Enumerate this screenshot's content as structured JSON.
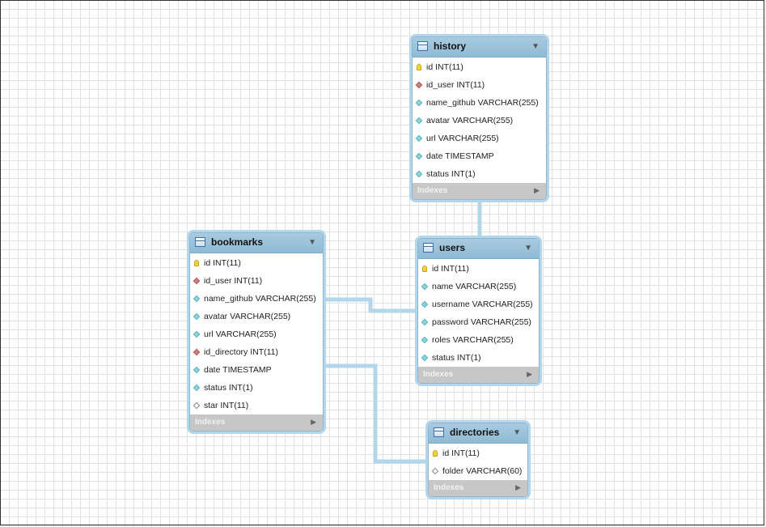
{
  "tables": {
    "history": {
      "title": "history",
      "footer": "Indexes",
      "columns": [
        {
          "text": "id INT(11)",
          "kind": "key"
        },
        {
          "text": "id_user INT(11)",
          "kind": "fk"
        },
        {
          "text": "name_github VARCHAR(255)",
          "kind": "col"
        },
        {
          "text": "avatar VARCHAR(255)",
          "kind": "col"
        },
        {
          "text": "url VARCHAR(255)",
          "kind": "col"
        },
        {
          "text": "date TIMESTAMP",
          "kind": "col"
        },
        {
          "text": "status INT(1)",
          "kind": "col"
        }
      ]
    },
    "bookmarks": {
      "title": "bookmarks",
      "footer": "Indexes",
      "columns": [
        {
          "text": "id INT(11)",
          "kind": "key"
        },
        {
          "text": "id_user INT(11)",
          "kind": "fk"
        },
        {
          "text": "name_github VARCHAR(255)",
          "kind": "col"
        },
        {
          "text": "avatar VARCHAR(255)",
          "kind": "col"
        },
        {
          "text": "url VARCHAR(255)",
          "kind": "col"
        },
        {
          "text": "id_directory INT(11)",
          "kind": "fk"
        },
        {
          "text": "date TIMESTAMP",
          "kind": "col"
        },
        {
          "text": "status INT(1)",
          "kind": "col"
        },
        {
          "text": "star INT(11)",
          "kind": "nul"
        }
      ]
    },
    "users": {
      "title": "users",
      "footer": "Indexes",
      "columns": [
        {
          "text": "id INT(11)",
          "kind": "key"
        },
        {
          "text": "name VARCHAR(255)",
          "kind": "col"
        },
        {
          "text": "username VARCHAR(255)",
          "kind": "col"
        },
        {
          "text": "password VARCHAR(255)",
          "kind": "col"
        },
        {
          "text": "roles VARCHAR(255)",
          "kind": "col"
        },
        {
          "text": "status INT(1)",
          "kind": "col"
        }
      ]
    },
    "directories": {
      "title": "directories",
      "footer": "Indexes",
      "columns": [
        {
          "text": "id INT(11)",
          "kind": "key"
        },
        {
          "text": "folder VARCHAR(60)",
          "kind": "nul"
        }
      ]
    }
  },
  "colors": {
    "header": "#9fc5dc",
    "link": "#b3d6ea",
    "footer": "#c7c7c7"
  }
}
